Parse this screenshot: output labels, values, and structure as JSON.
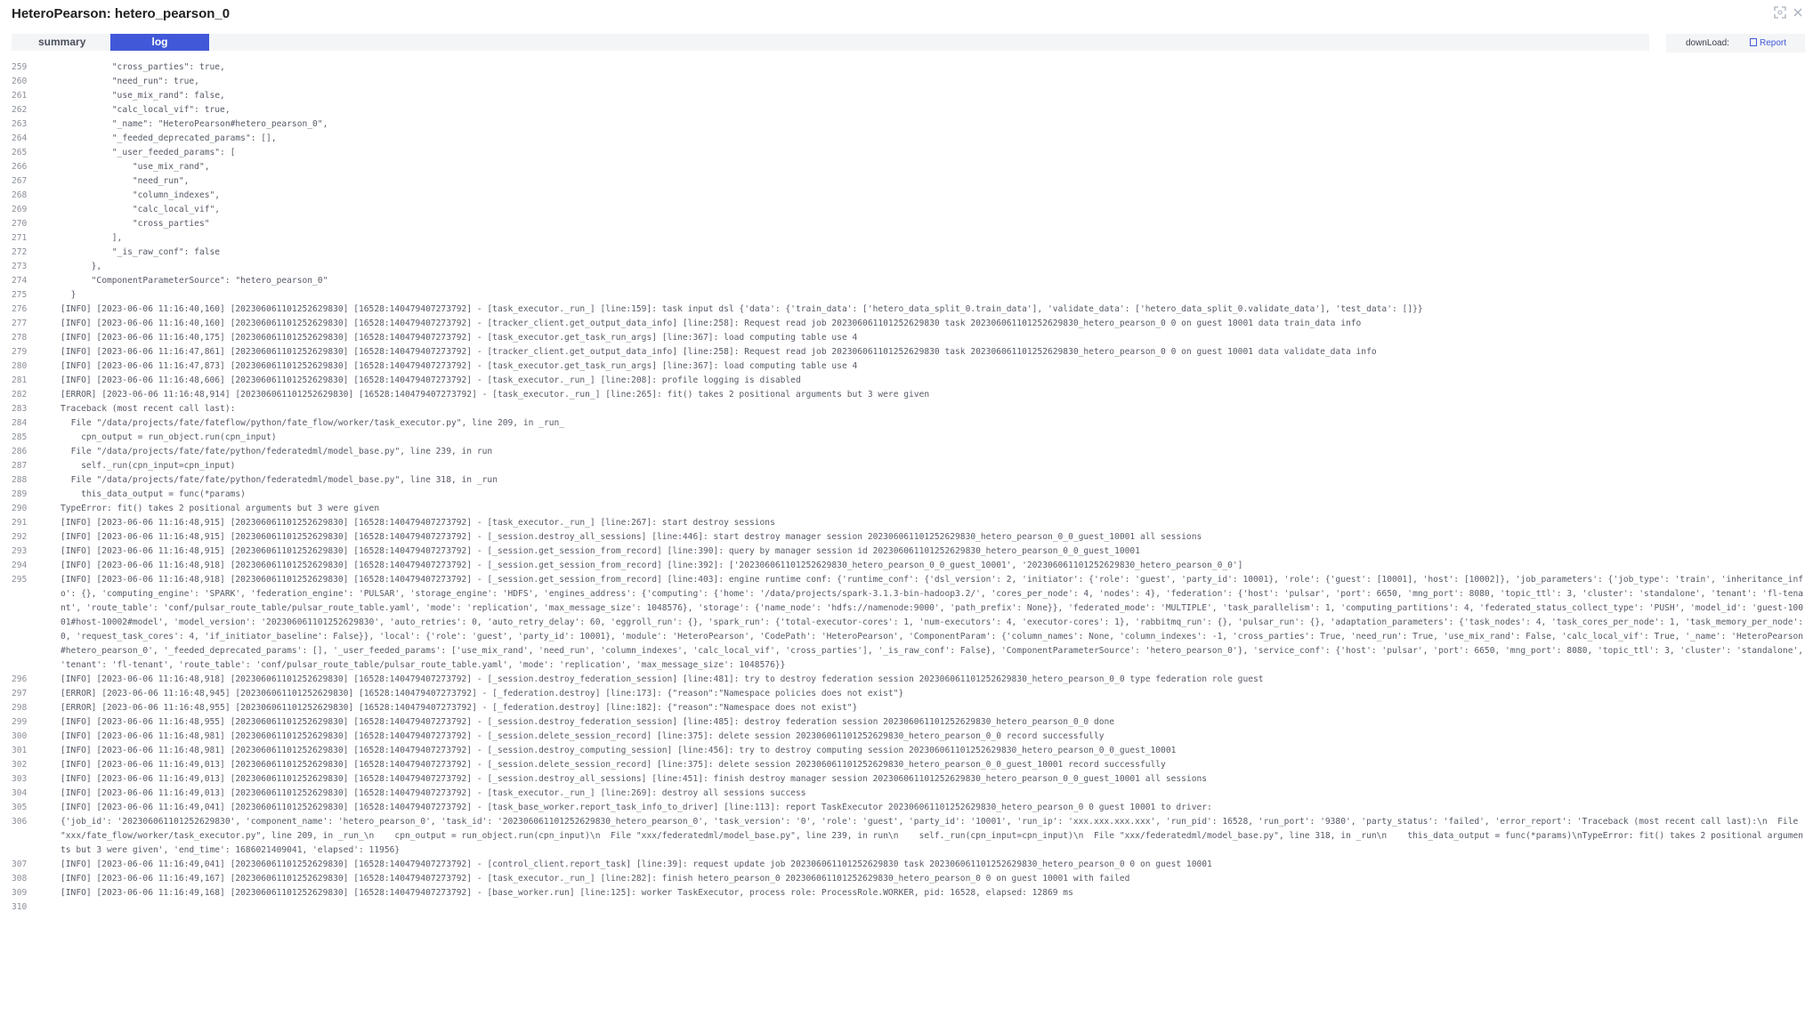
{
  "title": "HeteroPearson: hetero_pearson_0",
  "header_icons": {
    "fullscreen": "fullscreen-icon",
    "close": "close-icon"
  },
  "tabs": {
    "summary": "summary",
    "log": "log"
  },
  "download": {
    "label": "downLoad:",
    "report": "Report"
  },
  "colors": {
    "accent": "#4159d8",
    "text": "#555a66"
  },
  "log_lines": [
    {
      "n": "259",
      "t": "          \"cross_parties\": true,"
    },
    {
      "n": "260",
      "t": "          \"need_run\": true,"
    },
    {
      "n": "261",
      "t": "          \"use_mix_rand\": false,"
    },
    {
      "n": "262",
      "t": "          \"calc_local_vif\": true,"
    },
    {
      "n": "263",
      "t": "          \"_name\": \"HeteroPearson#hetero_pearson_0\","
    },
    {
      "n": "264",
      "t": "          \"_feeded_deprecated_params\": [],"
    },
    {
      "n": "265",
      "t": "          \"_user_feeded_params\": ["
    },
    {
      "n": "266",
      "t": "              \"use_mix_rand\","
    },
    {
      "n": "267",
      "t": "              \"need_run\","
    },
    {
      "n": "268",
      "t": "              \"column_indexes\","
    },
    {
      "n": "269",
      "t": "              \"calc_local_vif\","
    },
    {
      "n": "270",
      "t": "              \"cross_parties\""
    },
    {
      "n": "271",
      "t": "          ],"
    },
    {
      "n": "272",
      "t": "          \"_is_raw_conf\": false"
    },
    {
      "n": "273",
      "t": "      },"
    },
    {
      "n": "274",
      "t": "      \"ComponentParameterSource\": \"hetero_pearson_0\""
    },
    {
      "n": "275",
      "t": "  }"
    },
    {
      "n": "276",
      "t": "[INFO] [2023-06-06 11:16:40,160] [202306061101252629830] [16528:140479407273792] - [task_executor._run_] [line:159]: task input dsl {'data': {'train_data': ['hetero_data_split_0.train_data'], 'validate_data': ['hetero_data_split_0.validate_data'], 'test_data': []}}"
    },
    {
      "n": "277",
      "t": "[INFO] [2023-06-06 11:16:40,160] [202306061101252629830] [16528:140479407273792] - [tracker_client.get_output_data_info] [line:258]: Request read job 202306061101252629830 task 202306061101252629830_hetero_pearson_0 0 on guest 10001 data train_data info"
    },
    {
      "n": "278",
      "t": "[INFO] [2023-06-06 11:16:40,175] [202306061101252629830] [16528:140479407273792] - [task_executor.get_task_run_args] [line:367]: load computing table use 4"
    },
    {
      "n": "279",
      "t": "[INFO] [2023-06-06 11:16:47,861] [202306061101252629830] [16528:140479407273792] - [tracker_client.get_output_data_info] [line:258]: Request read job 202306061101252629830 task 202306061101252629830_hetero_pearson_0 0 on guest 10001 data validate_data info"
    },
    {
      "n": "280",
      "t": "[INFO] [2023-06-06 11:16:47,873] [202306061101252629830] [16528:140479407273792] - [task_executor.get_task_run_args] [line:367]: load computing table use 4"
    },
    {
      "n": "281",
      "t": "[INFO] [2023-06-06 11:16:48,606] [202306061101252629830] [16528:140479407273792] - [task_executor._run_] [line:208]: profile logging is disabled"
    },
    {
      "n": "282",
      "t": "[ERROR] [2023-06-06 11:16:48,914] [202306061101252629830] [16528:140479407273792] - [task_executor._run_] [line:265]: fit() takes 2 positional arguments but 3 were given"
    },
    {
      "n": "283",
      "t": "Traceback (most recent call last):"
    },
    {
      "n": "284",
      "t": "  File \"/data/projects/fate/fateflow/python/fate_flow/worker/task_executor.py\", line 209, in _run_"
    },
    {
      "n": "285",
      "t": "    cpn_output = run_object.run(cpn_input)"
    },
    {
      "n": "286",
      "t": "  File \"/data/projects/fate/fate/python/federatedml/model_base.py\", line 239, in run"
    },
    {
      "n": "287",
      "t": "    self._run(cpn_input=cpn_input)"
    },
    {
      "n": "288",
      "t": "  File \"/data/projects/fate/fate/python/federatedml/model_base.py\", line 318, in _run"
    },
    {
      "n": "289",
      "t": "    this_data_output = func(*params)"
    },
    {
      "n": "290",
      "t": "TypeError: fit() takes 2 positional arguments but 3 were given"
    },
    {
      "n": "291",
      "t": "[INFO] [2023-06-06 11:16:48,915] [202306061101252629830] [16528:140479407273792] - [task_executor._run_] [line:267]: start destroy sessions"
    },
    {
      "n": "292",
      "t": "[INFO] [2023-06-06 11:16:48,915] [202306061101252629830] [16528:140479407273792] - [_session.destroy_all_sessions] [line:446]: start destroy manager session 202306061101252629830_hetero_pearson_0_0_guest_10001 all sessions"
    },
    {
      "n": "293",
      "t": "[INFO] [2023-06-06 11:16:48,915] [202306061101252629830] [16528:140479407273792] - [_session.get_session_from_record] [line:390]: query by manager session id 202306061101252629830_hetero_pearson_0_0_guest_10001"
    },
    {
      "n": "294",
      "t": "[INFO] [2023-06-06 11:16:48,918] [202306061101252629830] [16528:140479407273792] - [_session.get_session_from_record] [line:392]: ['202306061101252629830_hetero_pearson_0_0_guest_10001', '202306061101252629830_hetero_pearson_0_0']"
    },
    {
      "n": "295",
      "t": "[INFO] [2023-06-06 11:16:48,918] [202306061101252629830] [16528:140479407273792] - [_session.get_session_from_record] [line:403]: engine runtime conf: {'runtime_conf': {'dsl_version': 2, 'initiator': {'role': 'guest', 'party_id': 10001}, 'role': {'guest': [10001], 'host': [10002]}, 'job_parameters': {'job_type': 'train', 'inheritance_info': {}, 'computing_engine': 'SPARK', 'federation_engine': 'PULSAR', 'storage_engine': 'HDFS', 'engines_address': {'computing': {'home': '/data/projects/spark-3.1.3-bin-hadoop3.2/', 'cores_per_node': 4, 'nodes': 4}, 'federation': {'host': 'pulsar', 'port': 6650, 'mng_port': 8080, 'topic_ttl': 3, 'cluster': 'standalone', 'tenant': 'fl-tenant', 'route_table': 'conf/pulsar_route_table/pulsar_route_table.yaml', 'mode': 'replication', 'max_message_size': 1048576}, 'storage': {'name_node': 'hdfs://namenode:9000', 'path_prefix': None}}, 'federated_mode': 'MULTIPLE', 'task_parallelism': 1, 'computing_partitions': 4, 'federated_status_collect_type': 'PUSH', 'model_id': 'guest-10001#host-10002#model', 'model_version': '202306061101252629830', 'auto_retries': 0, 'auto_retry_delay': 60, 'eggroll_run': {}, 'spark_run': {'total-executor-cores': 1, 'num-executors': 4, 'executor-cores': 1}, 'rabbitmq_run': {}, 'pulsar_run': {}, 'adaptation_parameters': {'task_nodes': 4, 'task_cores_per_node': 1, 'task_memory_per_node': 0, 'request_task_cores': 4, 'if_initiator_baseline': False}}, 'local': {'role': 'guest', 'party_id': 10001}, 'module': 'HeteroPearson', 'CodePath': 'HeteroPearson', 'ComponentParam': {'column_names': None, 'column_indexes': -1, 'cross_parties': True, 'need_run': True, 'use_mix_rand': False, 'calc_local_vif': True, '_name': 'HeteroPearson#hetero_pearson_0', '_feeded_deprecated_params': [], '_user_feeded_params': ['use_mix_rand', 'need_run', 'column_indexes', 'calc_local_vif', 'cross_parties'], '_is_raw_conf': False}, 'ComponentParameterSource': 'hetero_pearson_0'}, 'service_conf': {'host': 'pulsar', 'port': 6650, 'mng_port': 8080, 'topic_ttl': 3, 'cluster': 'standalone', 'tenant': 'fl-tenant', 'route_table': 'conf/pulsar_route_table/pulsar_route_table.yaml', 'mode': 'replication', 'max_message_size': 1048576}}"
    },
    {
      "n": "296",
      "t": "[INFO] [2023-06-06 11:16:48,918] [202306061101252629830] [16528:140479407273792] - [_session.destroy_federation_session] [line:481]: try to destroy federation session 202306061101252629830_hetero_pearson_0_0 type federation role guest"
    },
    {
      "n": "297",
      "t": "[ERROR] [2023-06-06 11:16:48,945] [202306061101252629830] [16528:140479407273792] - [_federation.destroy] [line:173]: {\"reason\":\"Namespace policies does not exist\"}"
    },
    {
      "n": "298",
      "t": "[ERROR] [2023-06-06 11:16:48,955] [202306061101252629830] [16528:140479407273792] - [_federation.destroy] [line:182]: {\"reason\":\"Namespace does not exist\"}"
    },
    {
      "n": "299",
      "t": "[INFO] [2023-06-06 11:16:48,955] [202306061101252629830] [16528:140479407273792] - [_session.destroy_federation_session] [line:485]: destroy federation session 202306061101252629830_hetero_pearson_0_0 done"
    },
    {
      "n": "300",
      "t": "[INFO] [2023-06-06 11:16:48,981] [202306061101252629830] [16528:140479407273792] - [_session.delete_session_record] [line:375]: delete session 202306061101252629830_hetero_pearson_0_0 record successfully"
    },
    {
      "n": "301",
      "t": "[INFO] [2023-06-06 11:16:48,981] [202306061101252629830] [16528:140479407273792] - [_session.destroy_computing_session] [line:456]: try to destroy computing session 202306061101252629830_hetero_pearson_0_0_guest_10001"
    },
    {
      "n": "302",
      "t": "[INFO] [2023-06-06 11:16:49,013] [202306061101252629830] [16528:140479407273792] - [_session.delete_session_record] [line:375]: delete session 202306061101252629830_hetero_pearson_0_0_guest_10001 record successfully"
    },
    {
      "n": "303",
      "t": "[INFO] [2023-06-06 11:16:49,013] [202306061101252629830] [16528:140479407273792] - [_session.destroy_all_sessions] [line:451]: finish destroy manager session 202306061101252629830_hetero_pearson_0_0_guest_10001 all sessions"
    },
    {
      "n": "304",
      "t": "[INFO] [2023-06-06 11:16:49,013] [202306061101252629830] [16528:140479407273792] - [task_executor._run_] [line:269]: destroy all sessions success"
    },
    {
      "n": "305",
      "t": "[INFO] [2023-06-06 11:16:49,041] [202306061101252629830] [16528:140479407273792] - [task_base_worker.report_task_info_to_driver] [line:113]: report TaskExecutor 202306061101252629830_hetero_pearson_0 0 guest 10001 to driver:"
    },
    {
      "n": "306",
      "t": "{'job_id': '202306061101252629830', 'component_name': 'hetero_pearson_0', 'task_id': '202306061101252629830_hetero_pearson_0', 'task_version': '0', 'role': 'guest', 'party_id': '10001', 'run_ip': 'xxx.xxx.xxx.xxx', 'run_pid': 16528, 'run_port': '9380', 'party_status': 'failed', 'error_report': 'Traceback (most recent call last):\\n  File \"xxx/fate_flow/worker/task_executor.py\", line 209, in _run_\\n    cpn_output = run_object.run(cpn_input)\\n  File \"xxx/federatedml/model_base.py\", line 239, in run\\n    self._run(cpn_input=cpn_input)\\n  File \"xxx/federatedml/model_base.py\", line 318, in _run\\n    this_data_output = func(*params)\\nTypeError: fit() takes 2 positional arguments but 3 were given', 'end_time': 1686021409041, 'elapsed': 11956}"
    },
    {
      "n": "307",
      "t": "[INFO] [2023-06-06 11:16:49,041] [202306061101252629830] [16528:140479407273792] - [control_client.report_task] [line:39]: request update job 202306061101252629830 task 202306061101252629830_hetero_pearson_0 0 on guest 10001"
    },
    {
      "n": "308",
      "t": "[INFO] [2023-06-06 11:16:49,167] [202306061101252629830] [16528:140479407273792] - [task_executor._run_] [line:282]: finish hetero_pearson_0 202306061101252629830_hetero_pearson_0 0 on guest 10001 with failed"
    },
    {
      "n": "309",
      "t": "[INFO] [2023-06-06 11:16:49,168] [202306061101252629830] [16528:140479407273792] - [base_worker.run] [line:125]: worker TaskExecutor, process role: ProcessRole.WORKER, pid: 16528, elapsed: 12869 ms"
    },
    {
      "n": "310",
      "t": ""
    }
  ]
}
